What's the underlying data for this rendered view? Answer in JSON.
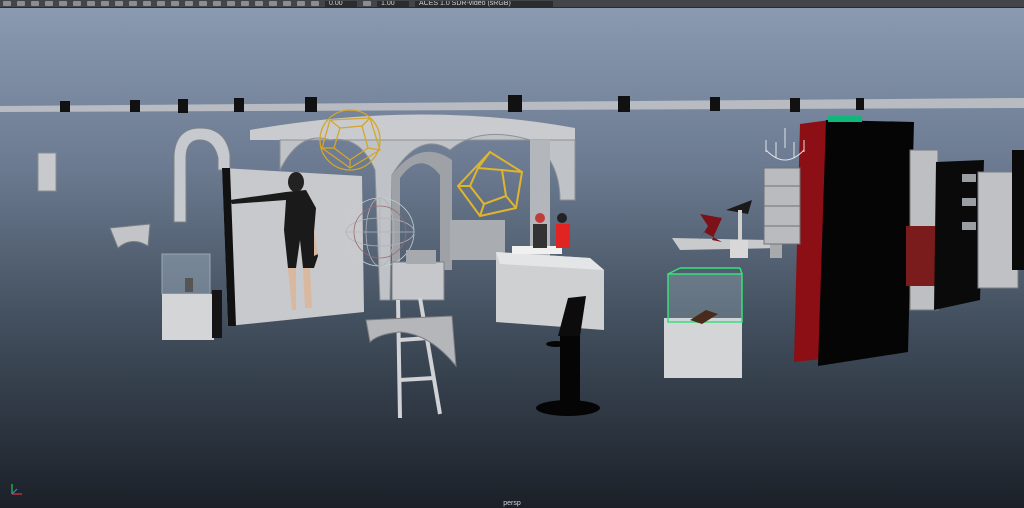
{
  "toolbar": {
    "time_value_a": "0.00",
    "time_value_b": "1.00",
    "color_space": "ACES 1.0 SDR-video (sRGB)",
    "icons": [
      "select-icon",
      "move-icon",
      "rotate-icon",
      "scale-icon",
      "snap-grid-icon",
      "snap-curve-icon",
      "snap-point-icon",
      "camera-icon",
      "bookmark-icon",
      "grid-toggle-icon",
      "wireframe-icon",
      "shaded-icon",
      "textured-icon",
      "lights-icon",
      "shadows-icon",
      "ao-icon",
      "aa-icon",
      "dof-icon",
      "isolate-icon",
      "xray-icon",
      "xray-joints-icon",
      "backface-icon",
      "exposure-icon",
      "gamma-icon"
    ]
  },
  "viewport": {
    "camera_label": "persp"
  },
  "colors": {
    "selection_highlight": "#39e07a",
    "gold_wire": "#d4a62a",
    "curtain_red": "#8b0f14",
    "stand_black": "#050505"
  }
}
